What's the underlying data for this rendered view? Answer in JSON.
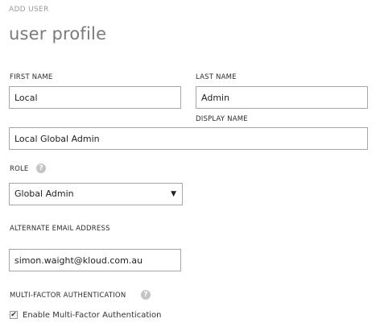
{
  "header": {
    "eyebrow": "ADD USER",
    "title": "user profile"
  },
  "form": {
    "first_name": {
      "label": "FIRST NAME",
      "value": "Local"
    },
    "last_name": {
      "label": "LAST NAME",
      "value": "Admin"
    },
    "display_name": {
      "label": "DISPLAY NAME",
      "value": "Local Global Admin"
    },
    "role": {
      "label": "ROLE",
      "selected": "Global Admin",
      "help_icon": "?"
    },
    "alternate_email": {
      "label": "ALTERNATE EMAIL ADDRESS",
      "value": "simon.waight@kloud.com.au"
    },
    "mfa": {
      "label": "MULTI-FACTOR AUTHENTICATION",
      "help_icon": "?",
      "checkbox_label": "Enable Multi-Factor Authentication",
      "checked": true,
      "check_glyph": "✔"
    }
  }
}
